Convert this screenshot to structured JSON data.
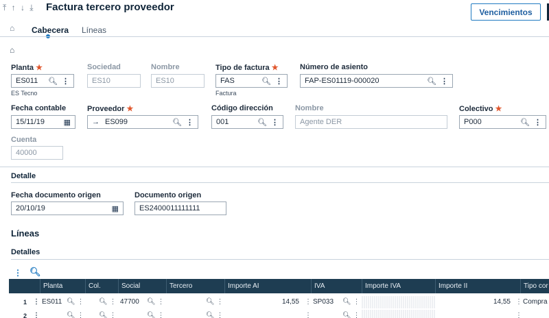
{
  "header": {
    "nav_arrows": "⤒ ↑ ↓ ⤓",
    "title": "Factura tercero proveedor",
    "vencimientos_label": "Vencimientos"
  },
  "tabs": [
    {
      "label": "Cabecera",
      "active": true
    },
    {
      "label": "Líneas",
      "active": false
    }
  ],
  "form": {
    "planta": {
      "label": "Planta",
      "value": "ES011",
      "sub": "ES Tecno"
    },
    "sociedad": {
      "label": "Sociedad",
      "value": "ES10"
    },
    "nombre1": {
      "label": "Nombre",
      "value": "ES10"
    },
    "tipo_factura": {
      "label": "Tipo de factura",
      "value": "FAS",
      "sub": "Factura"
    },
    "numero_asiento": {
      "label": "Número de asiento",
      "value": "FAP-ES01119-000020"
    },
    "fecha_contable": {
      "label": "Fecha contable",
      "value": "15/11/19"
    },
    "proveedor": {
      "label": "Proveedor",
      "value": "ES099"
    },
    "codigo_direccion": {
      "label": "Código dirección",
      "value": "001"
    },
    "nombre2": {
      "label": "Nombre",
      "value": "Agente DER"
    },
    "colectivo": {
      "label": "Colectivo",
      "value": "P000"
    },
    "cuenta": {
      "label": "Cuenta",
      "value": "40000"
    },
    "required_mark": "★"
  },
  "detalle": {
    "title": "Detalle",
    "fecha_doc_origen": {
      "label": "Fecha documento origen",
      "value": "20/10/19"
    },
    "documento_origen": {
      "label": "Documento origen",
      "value": "ES2400011111111"
    }
  },
  "lineas": {
    "title": "Líneas",
    "detalles_title": "Detalles",
    "columns": [
      "Planta",
      "Col.",
      "Social",
      "Tercero",
      "Importe AI",
      "IVA",
      "Importe IVA",
      "Importe II",
      "Tipo cor"
    ],
    "rows": [
      {
        "num": "1",
        "planta": "ES011",
        "social": "47700",
        "importe_ai": "14,55",
        "iva": "SP033",
        "importe_ii": "14,55",
        "tipo": "Compra"
      },
      {
        "num": "2",
        "planta": "",
        "social": "",
        "importe_ai": "",
        "iva": "",
        "importe_ii": "",
        "tipo": ""
      }
    ]
  },
  "colors": {
    "accent": "#1f7ac1",
    "grid_header": "#1e3d52",
    "required": "#e0562c"
  }
}
